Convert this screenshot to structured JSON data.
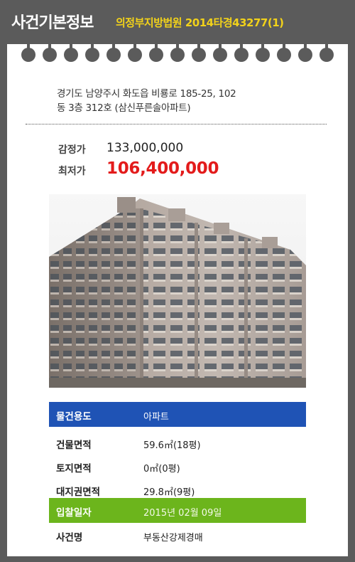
{
  "header": {
    "title": "사건기본정보",
    "court_case": "의정부지방법원 2014타경43277(1)"
  },
  "property": {
    "address_line1": "경기도 남양주시 화도읍 비룡로 185-25, 102",
    "address_line2": "동 3층 312호 (삼신푸른솔아파트)"
  },
  "prices": {
    "appraisal_label": "감정가",
    "appraisal_value": "133,000,000",
    "minimum_label": "최저가",
    "minimum_value": "106,400,000"
  },
  "details": [
    {
      "label": "물건용도",
      "value": "아파트"
    },
    {
      "label": "건물면적",
      "value": "59.6㎡(18평)"
    },
    {
      "label": "토지면적",
      "value": "0㎡(0평)"
    },
    {
      "label": "대지권면적",
      "value": "29.8㎡(9평)"
    },
    {
      "label": "입찰일자",
      "value": "2015년 02월 09일"
    },
    {
      "label": "사건명",
      "value": "부동산강제경매"
    }
  ],
  "colors": {
    "background": "#5b5b5b",
    "court_text": "#f2d21a",
    "minimum_price": "#e31b1b",
    "usage_row": "#1f53b5",
    "bid_date_row": "#6cb51c"
  }
}
